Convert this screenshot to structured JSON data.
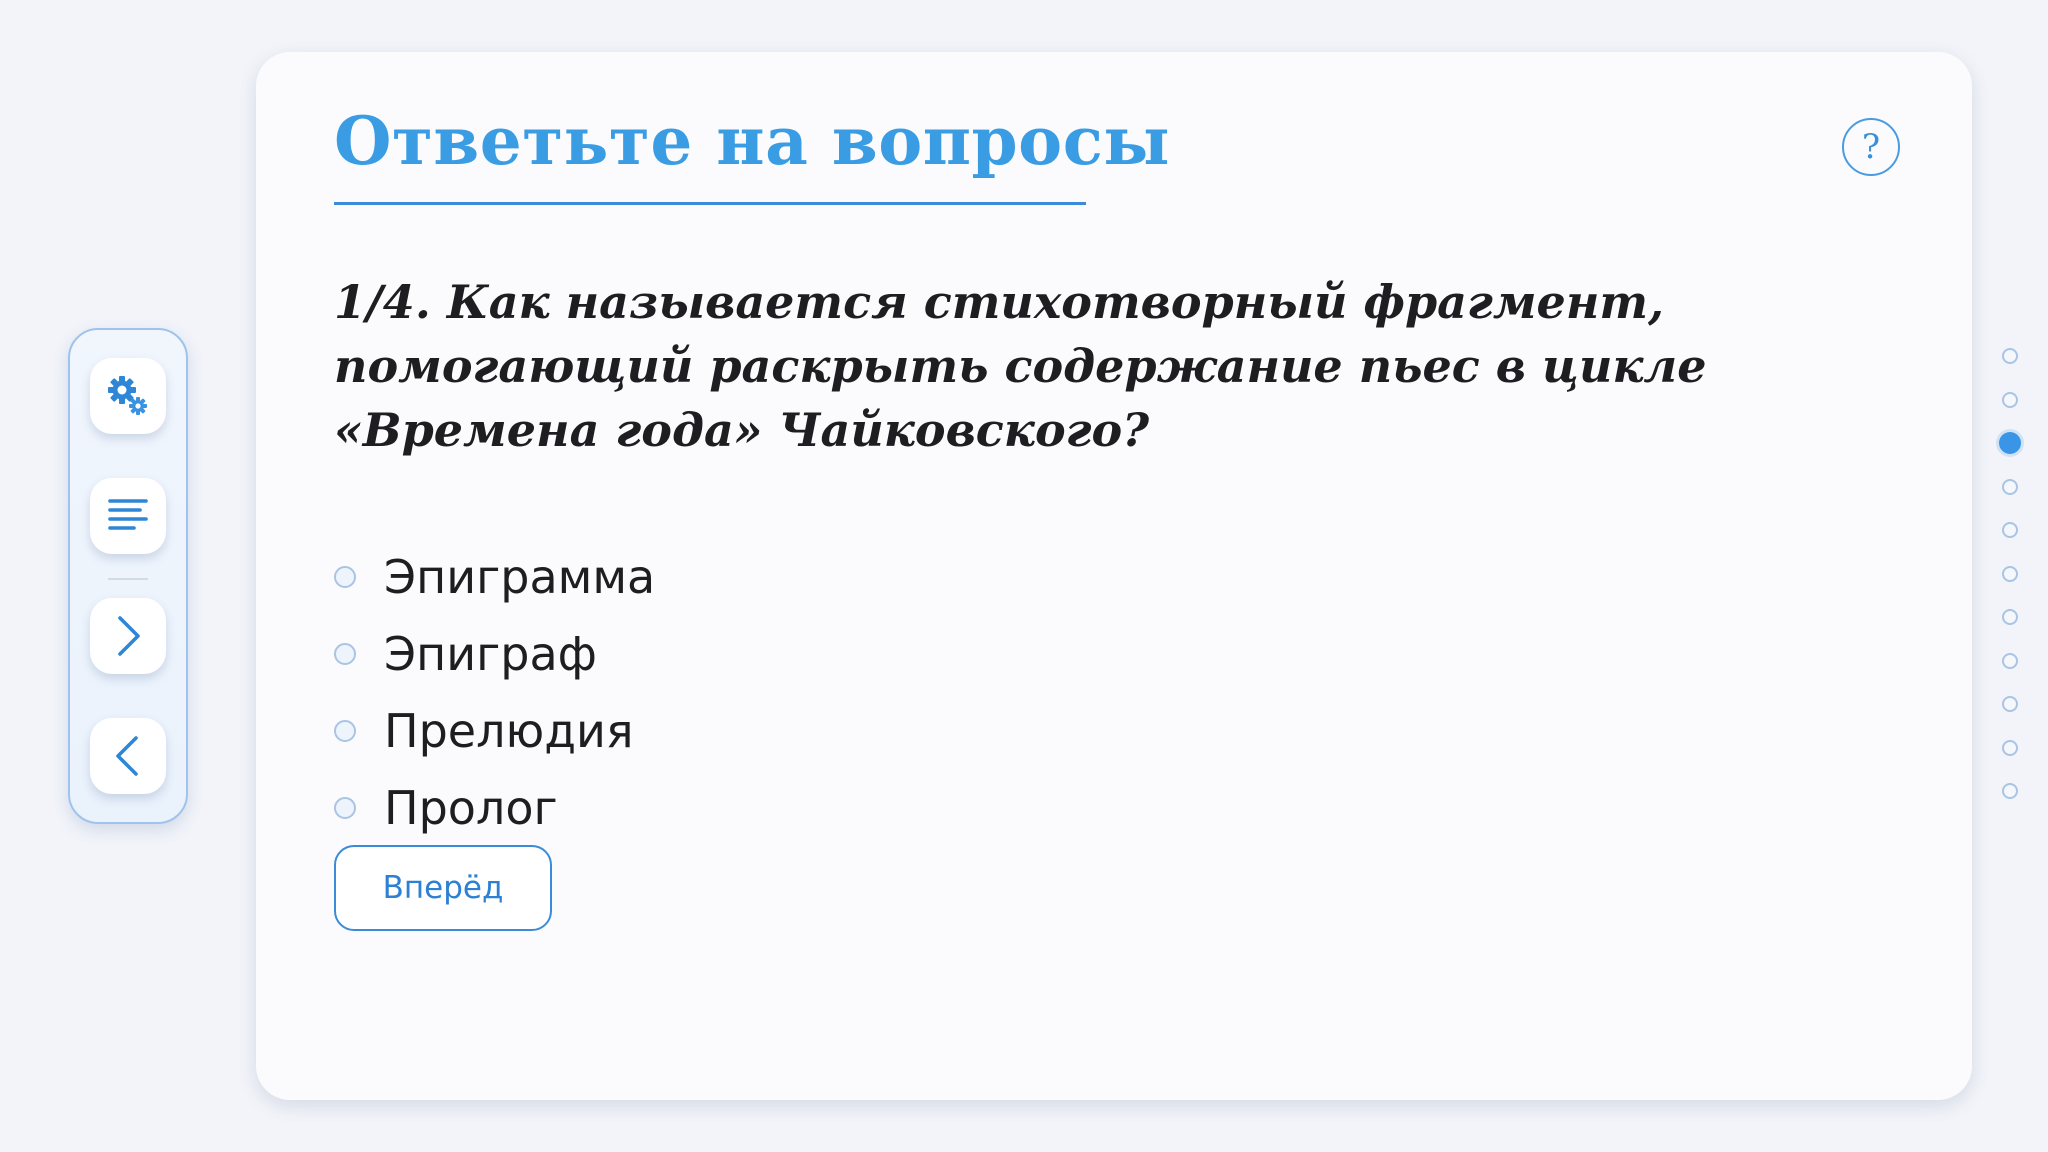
{
  "header": {
    "title": "Ответьте на вопросы",
    "help_label": "?"
  },
  "question": {
    "text": "1/4. Как называется стихотворный фрагмент, помогающий раскрыть содержание пьес в цикле «Времена года» Чайковского?"
  },
  "options": [
    {
      "label": "Эпиграмма",
      "selected": false
    },
    {
      "label": "Эпиграф",
      "selected": false
    },
    {
      "label": "Прелюдия",
      "selected": false
    },
    {
      "label": "Пролог",
      "selected": false
    }
  ],
  "actions": {
    "next_label": "Вперёд"
  },
  "toolbar": {
    "items": [
      {
        "icon": "gear-icon",
        "name": "settings"
      },
      {
        "icon": "list-icon",
        "name": "contents"
      },
      {
        "icon": "chevron-right-icon",
        "name": "next"
      },
      {
        "icon": "chevron-left-icon",
        "name": "previous"
      }
    ]
  },
  "progress": {
    "total": 11,
    "current": 3
  },
  "colors": {
    "accent": "#3a95e6",
    "title": "#3a9de3",
    "text": "#1e1e22",
    "background": "#f2f4f9",
    "card": "#fbfbfe"
  }
}
